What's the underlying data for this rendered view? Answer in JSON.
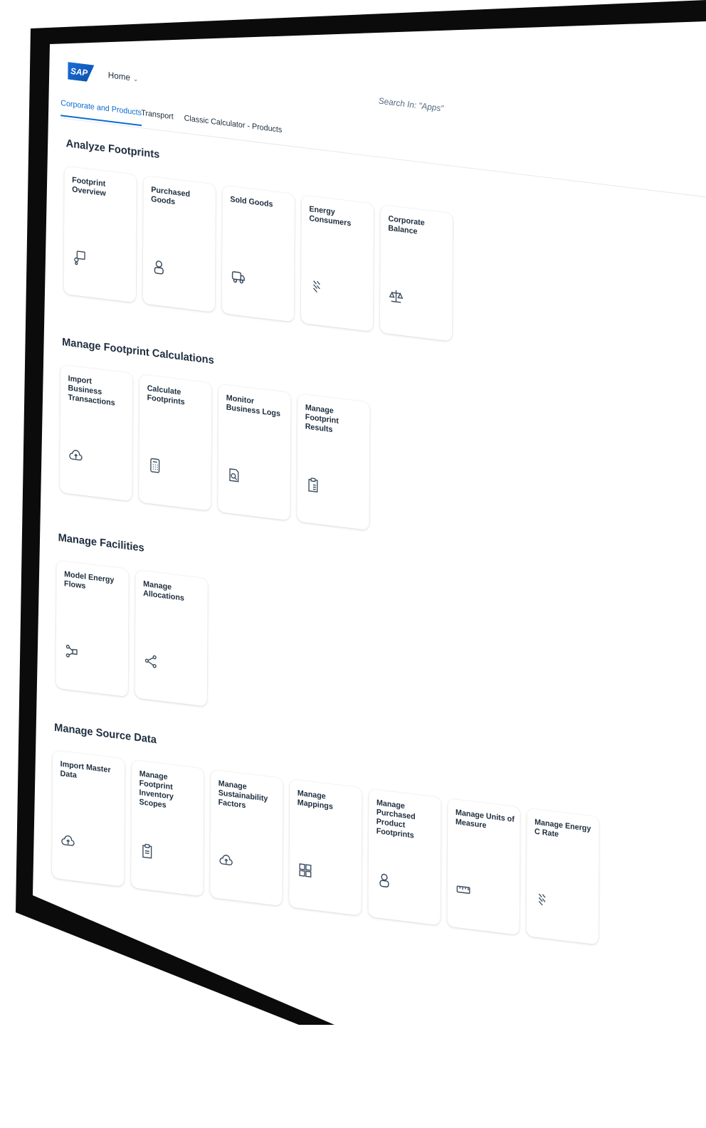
{
  "shell": {
    "home_label": "Home",
    "search_placeholder": "Search In: \"Apps\"",
    "logo_text": "SAP"
  },
  "tabs": [
    {
      "label": "Corporate and Products",
      "active": true
    },
    {
      "label": "Transport",
      "active": false
    },
    {
      "label": "Classic Calculator - Products",
      "active": false
    }
  ],
  "sections": [
    {
      "title": "Analyze Footprints",
      "tiles": [
        {
          "label": "Footprint Overview",
          "icon": "overview-icon"
        },
        {
          "label": "Purchased Goods",
          "icon": "supplier-icon"
        },
        {
          "label": "Sold Goods",
          "icon": "truck-icon"
        },
        {
          "label": "Energy Consumers",
          "icon": "energy-icon"
        },
        {
          "label": "Corporate Balance",
          "icon": "balance-scale-icon"
        }
      ]
    },
    {
      "title": "Manage Footprint Calculations",
      "tiles": [
        {
          "label": "Import Business Transactions",
          "icon": "cloud-upload-icon"
        },
        {
          "label": "Calculate Footprints",
          "icon": "calculator-icon"
        },
        {
          "label": "Monitor Business Logs",
          "icon": "log-search-icon"
        },
        {
          "label": "Manage Footprint Results",
          "icon": "clipboard-list-icon"
        }
      ]
    },
    {
      "title": "Manage Facilities",
      "tiles": [
        {
          "label": "Model Energy Flows",
          "icon": "flow-icon"
        },
        {
          "label": "Manage Allocations",
          "icon": "share-icon"
        }
      ]
    },
    {
      "title": "Manage Source Data",
      "tiles": [
        {
          "label": "Import Master Data",
          "icon": "cloud-upload-icon"
        },
        {
          "label": "Manage Footprint Inventory Scopes",
          "icon": "document-icon"
        },
        {
          "label": "Manage Sustainability Factors",
          "icon": "cloud-upload-icon"
        },
        {
          "label": "Manage Mappings",
          "icon": "mapping-icon"
        },
        {
          "label": "Manage Purchased Product Footprints",
          "icon": "supplier-icon"
        },
        {
          "label": "Manage Units of Measure",
          "icon": "ruler-icon"
        },
        {
          "label": "Manage Energy C Rate",
          "icon": "energy-icon"
        }
      ]
    }
  ]
}
